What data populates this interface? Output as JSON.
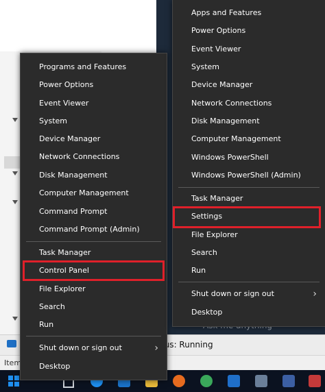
{
  "left_menu": {
    "items": [
      {
        "label": "Programs and Features"
      },
      {
        "label": "Power Options"
      },
      {
        "label": "Event Viewer"
      },
      {
        "label": "System"
      },
      {
        "label": "Device Manager"
      },
      {
        "label": "Network Connections"
      },
      {
        "label": "Disk Management"
      },
      {
        "label": "Computer Management"
      },
      {
        "label": "Command Prompt"
      },
      {
        "label": "Command Prompt (Admin)"
      },
      {
        "label": "Task Manager"
      },
      {
        "label": "Control Panel"
      },
      {
        "label": "File Explorer"
      },
      {
        "label": "Search"
      },
      {
        "label": "Run"
      },
      {
        "label": "Shut down or sign out"
      },
      {
        "label": "Desktop"
      }
    ],
    "highlighted": "Control Panel"
  },
  "right_menu": {
    "items": [
      {
        "label": "Apps and Features"
      },
      {
        "label": "Power Options"
      },
      {
        "label": "Event Viewer"
      },
      {
        "label": "System"
      },
      {
        "label": "Device Manager"
      },
      {
        "label": "Network Connections"
      },
      {
        "label": "Disk Management"
      },
      {
        "label": "Computer Management"
      },
      {
        "label": "Windows PowerShell"
      },
      {
        "label": "Windows PowerShell (Admin)"
      },
      {
        "label": "Task Manager"
      },
      {
        "label": "Settings"
      },
      {
        "label": "File Explorer"
      },
      {
        "label": "Search"
      },
      {
        "label": "Run"
      },
      {
        "label": "Shut down or sign out"
      },
      {
        "label": "Desktop"
      }
    ],
    "highlighted": "Settings"
  },
  "background": {
    "status_text": "tus: Running",
    "items_text": "Items",
    "ghost_text": "Ask me anything"
  },
  "icons": {
    "submenu_chevron": "chevron-right-icon",
    "start": "windows-start-icon"
  },
  "colors": {
    "menu_bg": "#2b2b2b",
    "highlight": "#e0202a",
    "taskbar": "#0b1220"
  }
}
